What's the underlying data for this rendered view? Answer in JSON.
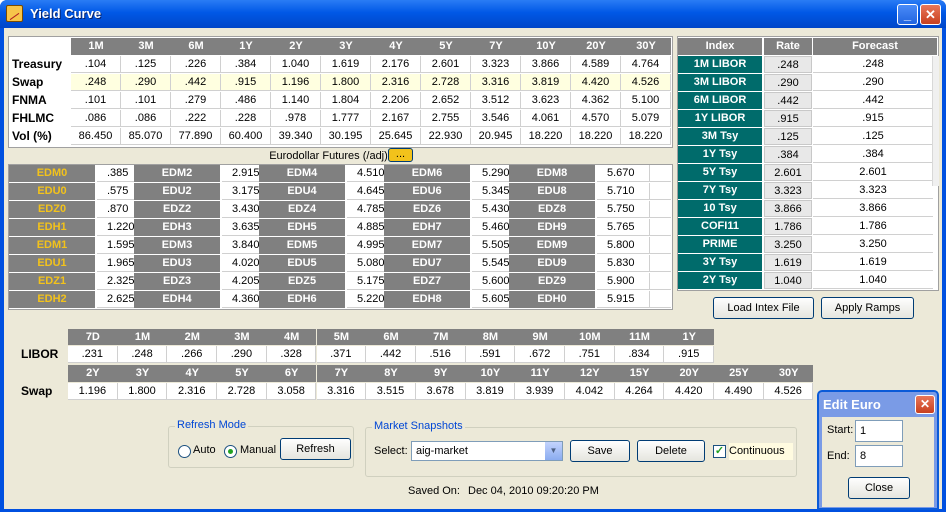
{
  "window": {
    "title": "Yield Curve",
    "minimize_label": "_",
    "close_label": "✕"
  },
  "rates": {
    "columns": [
      "1M",
      "3M",
      "6M",
      "1Y",
      "2Y",
      "3Y",
      "4Y",
      "5Y",
      "7Y",
      "10Y",
      "20Y",
      "30Y"
    ],
    "rows": [
      {
        "label": "Treasury",
        "values": [
          ".104",
          ".125",
          ".226",
          ".384",
          "1.040",
          "1.619",
          "2.176",
          "2.601",
          "3.323",
          "3.866",
          "4.589",
          "4.764"
        ]
      },
      {
        "label": "Swap",
        "values": [
          ".248",
          ".290",
          ".442",
          ".915",
          "1.196",
          "1.800",
          "2.316",
          "2.728",
          "3.316",
          "3.819",
          "4.420",
          "4.526"
        ]
      },
      {
        "label": "FNMA",
        "values": [
          ".101",
          ".101",
          ".279",
          ".486",
          "1.140",
          "1.804",
          "2.206",
          "2.652",
          "3.512",
          "3.623",
          "4.362",
          "5.100"
        ]
      },
      {
        "label": "FHLMC",
        "values": [
          ".086",
          ".086",
          ".222",
          ".228",
          ".978",
          "1.777",
          "2.167",
          "2.755",
          "3.546",
          "4.061",
          "4.570",
          "5.079"
        ]
      },
      {
        "label": "Vol (%)",
        "values": [
          "86.450",
          "85.070",
          "77.890",
          "60.400",
          "39.340",
          "30.195",
          "25.645",
          "22.930",
          "20.945",
          "18.220",
          "18.220",
          "18.220"
        ]
      }
    ]
  },
  "eurodollar": {
    "label": "Eurodollar Futures (/adj)",
    "button": "...",
    "columns": [
      [
        [
          "EDM0",
          ".385"
        ],
        [
          "EDU0",
          ".575"
        ],
        [
          "EDZ0",
          ".870"
        ],
        [
          "EDH1",
          "1.220"
        ],
        [
          "EDM1",
          "1.595"
        ],
        [
          "EDU1",
          "1.965"
        ],
        [
          "EDZ1",
          "2.325"
        ],
        [
          "EDH2",
          "2.625"
        ]
      ],
      [
        [
          "EDM2",
          "2.915"
        ],
        [
          "EDU2",
          "3.175"
        ],
        [
          "EDZ2",
          "3.430"
        ],
        [
          "EDH3",
          "3.635"
        ],
        [
          "EDM3",
          "3.840"
        ],
        [
          "EDU3",
          "4.020"
        ],
        [
          "EDZ3",
          "4.205"
        ],
        [
          "EDH4",
          "4.360"
        ]
      ],
      [
        [
          "EDM4",
          "4.510"
        ],
        [
          "EDU4",
          "4.645"
        ],
        [
          "EDZ4",
          "4.785"
        ],
        [
          "EDH5",
          "4.885"
        ],
        [
          "EDM5",
          "4.995"
        ],
        [
          "EDU5",
          "5.080"
        ],
        [
          "EDZ5",
          "5.175"
        ],
        [
          "EDH6",
          "5.220"
        ]
      ],
      [
        [
          "EDM6",
          "5.290"
        ],
        [
          "EDU6",
          "5.345"
        ],
        [
          "EDZ6",
          "5.430"
        ],
        [
          "EDH7",
          "5.460"
        ],
        [
          "EDM7",
          "5.505"
        ],
        [
          "EDU7",
          "5.545"
        ],
        [
          "EDZ7",
          "5.600"
        ],
        [
          "EDH8",
          "5.605"
        ]
      ],
      [
        [
          "EDM8",
          "5.670"
        ],
        [
          "EDU8",
          "5.710"
        ],
        [
          "EDZ8",
          "5.750"
        ],
        [
          "EDH9",
          "5.765"
        ],
        [
          "EDM9",
          "5.800"
        ],
        [
          "EDU9",
          "5.830"
        ],
        [
          "EDZ9",
          "5.900"
        ],
        [
          "EDH0",
          "5.915"
        ]
      ]
    ]
  },
  "index": {
    "headers": [
      "Index",
      "Rate",
      "Forecast"
    ],
    "rows": [
      [
        "1M LIBOR",
        ".248",
        ".248"
      ],
      [
        "3M LIBOR",
        ".290",
        ".290"
      ],
      [
        "6M LIBOR",
        ".442",
        ".442"
      ],
      [
        "1Y LIBOR",
        ".915",
        ".915"
      ],
      [
        "3M Tsy",
        ".125",
        ".125"
      ],
      [
        "1Y Tsy",
        ".384",
        ".384"
      ],
      [
        "5Y Tsy",
        "2.601",
        "2.601"
      ],
      [
        "7Y Tsy",
        "3.323",
        "3.323"
      ],
      [
        "10 Tsy",
        "3.866",
        "3.866"
      ],
      [
        "COFI11",
        "1.786",
        "1.786"
      ],
      [
        "PRIME",
        "3.250",
        "3.250"
      ],
      [
        "3Y Tsy",
        "1.619",
        "1.619"
      ],
      [
        "2Y Tsy",
        "1.040",
        "1.040"
      ]
    ],
    "load_button": "Load Intex File",
    "apply_button": "Apply Ramps"
  },
  "libor": {
    "label": "LIBOR",
    "columns": [
      "7D",
      "1M",
      "2M",
      "3M",
      "4M",
      "5M",
      "6M",
      "7M",
      "8M",
      "9M",
      "10M",
      "11M",
      "1Y"
    ],
    "values": [
      ".231",
      ".248",
      ".266",
      ".290",
      ".328",
      ".371",
      ".442",
      ".516",
      ".591",
      ".672",
      ".751",
      ".834",
      ".915"
    ]
  },
  "swap": {
    "label": "Swap",
    "columns": [
      "2Y",
      "3Y",
      "4Y",
      "5Y",
      "6Y",
      "7Y",
      "8Y",
      "9Y",
      "10Y",
      "11Y",
      "12Y",
      "15Y",
      "20Y",
      "25Y",
      "30Y"
    ],
    "values": [
      "1.196",
      "1.800",
      "2.316",
      "2.728",
      "3.058",
      "3.316",
      "3.515",
      "3.678",
      "3.819",
      "3.939",
      "4.042",
      "4.264",
      "4.420",
      "4.490",
      "4.526"
    ]
  },
  "refresh": {
    "title": "Refresh Mode",
    "auto": "Auto",
    "manual": "Manual",
    "button": "Refresh",
    "selected": "Manual"
  },
  "snapshots": {
    "title": "Market Snapshots",
    "select_label": "Select:",
    "selected": "aig-market",
    "save": "Save",
    "delete": "Delete",
    "continuous": "Continuous",
    "continuous_checked": true
  },
  "saved": {
    "label": "Saved On:",
    "value": "Dec 04, 2010 09:20:20 PM"
  },
  "edit_dialog": {
    "title": "Edit Euro",
    "start_label": "Start:",
    "start_value": "1",
    "end_label": "End:",
    "end_value": "8",
    "close_button": "Close"
  },
  "colors": {
    "title_bar": "#0058e6",
    "header_gray": "#808080",
    "index_teal": "#006b6b",
    "euro_label": "#f2c21b",
    "swap_highlight": "#ffffe0"
  }
}
